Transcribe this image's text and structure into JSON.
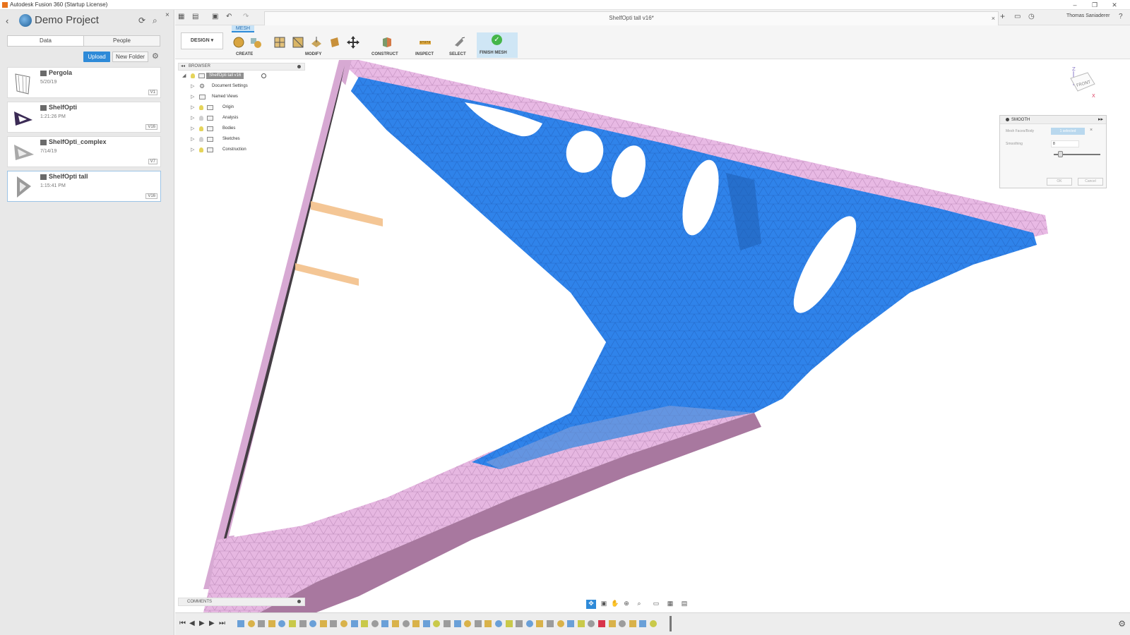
{
  "window": {
    "title": "Autodesk Fusion 360 (Startup License)",
    "controls": [
      "–",
      "❐",
      "✕"
    ]
  },
  "data_panel": {
    "project_title": "Demo Project",
    "tabs": [
      {
        "label": "Data",
        "active": true
      },
      {
        "label": "People",
        "active": false
      }
    ],
    "upload_label": "Upload",
    "new_folder_label": "New Folder",
    "files": [
      {
        "name": "Pergola",
        "date": "5/20/19",
        "version": "V1"
      },
      {
        "name": "ShelfOpti",
        "date": "1:21:26 PM",
        "version": "V16"
      },
      {
        "name": "ShelfOpti_complex",
        "date": "7/14/19",
        "version": "V7"
      },
      {
        "name": "ShelfOpti tall",
        "date": "1:15:41 PM",
        "version": "V16",
        "selected": true
      }
    ]
  },
  "document": {
    "tab_title": "ShelfOpti tall v16*",
    "user_name": "Thomas Saniaderer"
  },
  "toolbar": {
    "workspace_label": "DESIGN",
    "active_tab": "MESH",
    "groups": [
      {
        "label": "CREATE"
      },
      {
        "label": "MODIFY"
      },
      {
        "label": "CONSTRUCT"
      },
      {
        "label": "INSPECT"
      },
      {
        "label": "SELECT"
      }
    ],
    "finish_label": "FINISH MESH"
  },
  "browser": {
    "header": "BROWSER",
    "root": "ShelfOpti tall v16",
    "items": [
      "Document Settings",
      "Named Views",
      "Origin",
      "Analysis",
      "Bodies",
      "Sketches",
      "Construction"
    ]
  },
  "smooth_panel": {
    "title": "SMOOTH",
    "mesh_label": "Mesh Faces/Body",
    "selection_chip": "1 selected",
    "smoothing_label": "Smoothing",
    "smoothing_value": "8",
    "ok_label": "OK",
    "cancel_label": "Cancel"
  },
  "viewcube": {
    "face": "FRONT",
    "axis_z": "Z",
    "axis_x": "X"
  },
  "comments": {
    "label": "COMMENTS"
  },
  "colors": {
    "accent": "#2e8ad8",
    "mesh_blue": "#2f83ea",
    "mesh_pink": "#e7b8e3"
  }
}
